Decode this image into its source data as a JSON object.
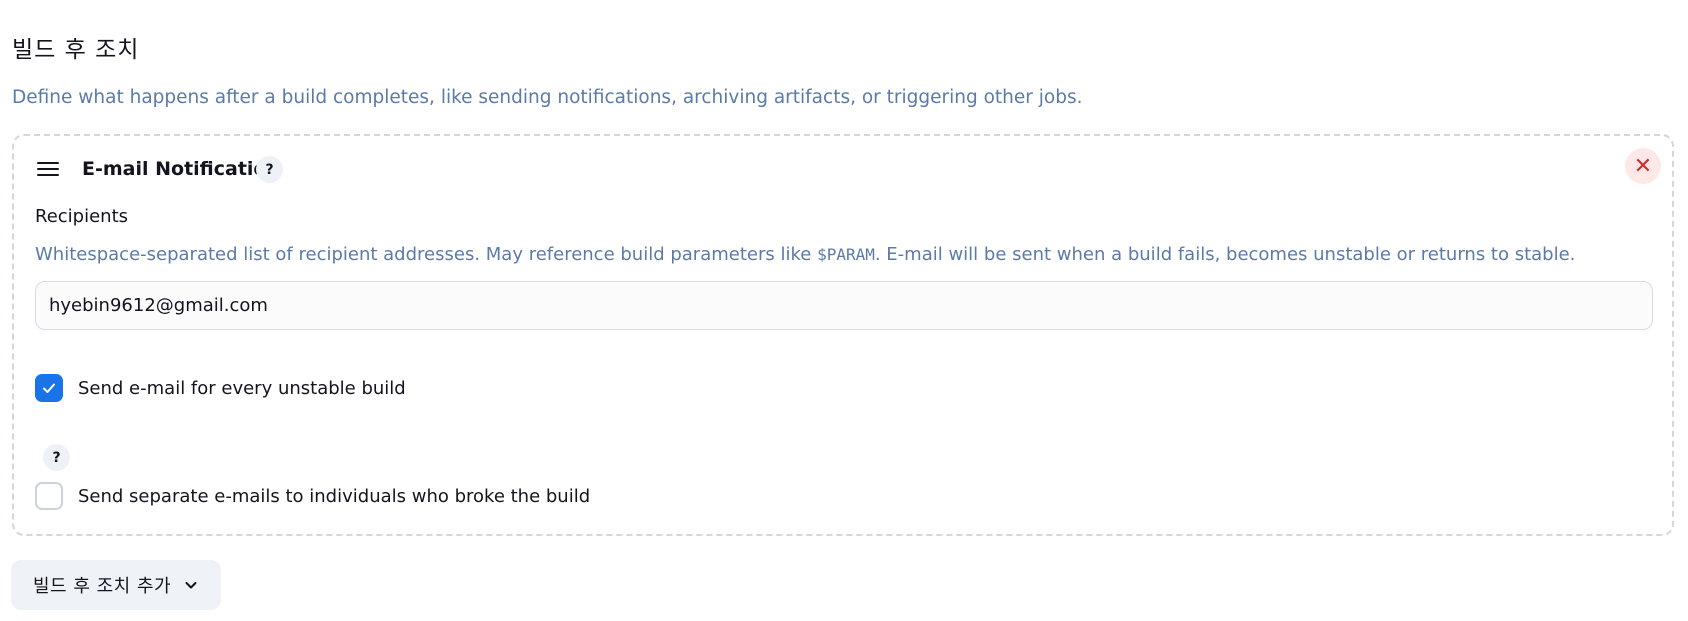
{
  "section": {
    "title": "빌드 후 조치",
    "description": "Define what happens after a build completes, like sending notifications, archiving artifacts, or triggering other jobs."
  },
  "card": {
    "title": "E-mail Notification",
    "help_glyph": "?",
    "close_glyph": "✕",
    "drag_icon": "hamburger-icon",
    "recipients": {
      "label": "Recipients",
      "desc_before": "Whitespace-separated list of recipient addresses. May reference build parameters like ",
      "desc_code": "$PARAM",
      "desc_after": ". E-mail will be sent when a build fails, becomes unstable or returns to stable.",
      "value": "hyebin9612@gmail.com"
    },
    "unstable": {
      "label": "Send e-mail for every unstable build",
      "checked": true
    },
    "individuals": {
      "help_glyph": "?",
      "label": "Send separate e-mails to individuals who broke the build",
      "checked": false
    }
  },
  "add_button": {
    "label": "빌드 후 조치 추가",
    "icon": "chevron-down-icon"
  },
  "colors": {
    "accent": "#1a73e8",
    "description_text": "#5c7aa8",
    "danger": "#d12b2b"
  }
}
